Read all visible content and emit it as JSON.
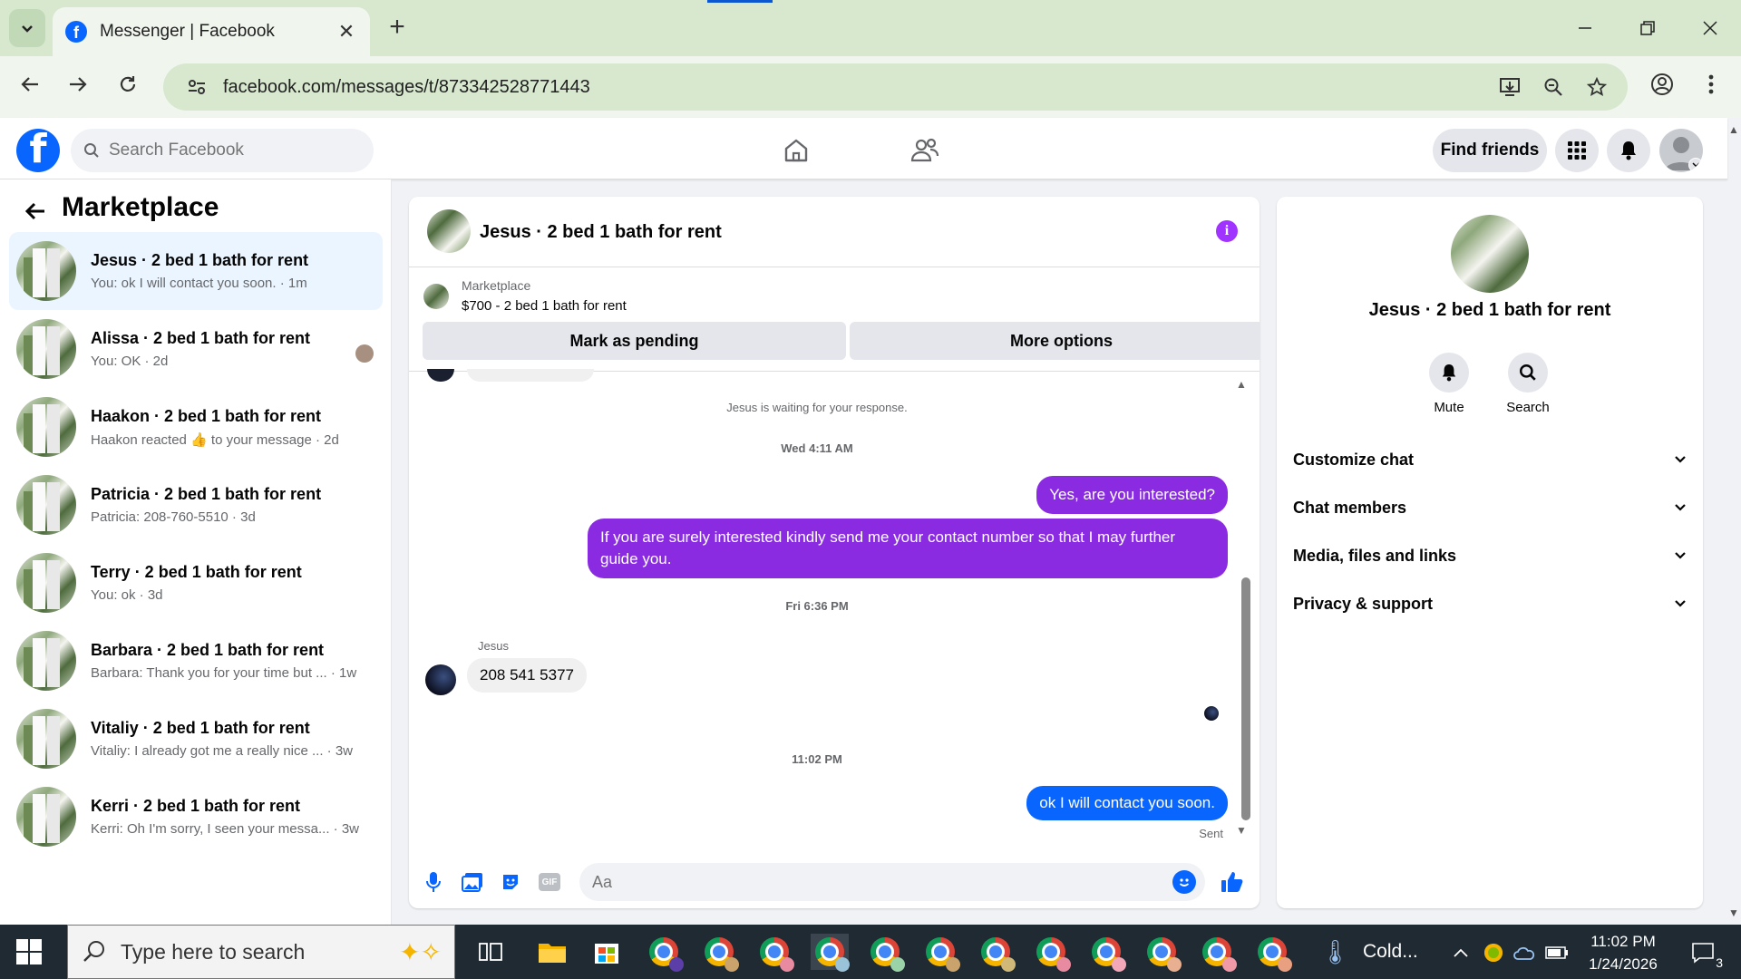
{
  "browser": {
    "tab_title": "Messenger | Facebook",
    "url": "facebook.com/messages/t/873342528771443"
  },
  "fb_header": {
    "search_placeholder": "Search Facebook",
    "find_friends_label": "Find friends"
  },
  "sidebar": {
    "title": "Marketplace",
    "conversations": [
      {
        "name": "Jesus · 2 bed 1 bath for rent",
        "preview": "You: ok I will contact you soon. · 1m",
        "active": true
      },
      {
        "name": "Alissa · 2 bed 1 bath for rent",
        "preview": "You: OK · 2d"
      },
      {
        "name": "Haakon · 2 bed 1 bath for rent",
        "preview": "Haakon reacted 👍 to your message · 2d"
      },
      {
        "name": "Patricia · 2 bed 1 bath for rent",
        "preview": "Patricia: 208-760-5510 · 3d"
      },
      {
        "name": "Terry · 2 bed 1 bath for rent",
        "preview": "You: ok · 3d"
      },
      {
        "name": "Barbara · 2 bed 1 bath for rent",
        "preview": "Barbara: Thank you for your time but ... · 1w"
      },
      {
        "name": "Vitaliy · 2 bed 1 bath for rent",
        "preview": "Vitaliy: I already got me a really nice ... · 3w"
      },
      {
        "name": "Kerri · 2 bed 1 bath for rent",
        "preview": "Kerri: Oh I'm sorry, I seen your messa... · 3w"
      }
    ]
  },
  "chat": {
    "title": "Jesus · 2 bed 1 bath for rent",
    "marketplace_label": "Marketplace",
    "listing": "$700 - 2 bed 1 bath for rent",
    "mark_pending_label": "Mark as pending",
    "more_options_label": "More options",
    "waiting_text": "Jesus is waiting for your response.",
    "ts1": "Wed 4:11 AM",
    "msg1": "Yes, are you interested?",
    "msg2": "If you are surely interested kindly send me your contact number so that I may further guide you.",
    "ts2": "Fri 6:36 PM",
    "sender": "Jesus",
    "msg3": "208 541 5377",
    "ts3": "11:02 PM",
    "msg4": "ok I will contact you soon.",
    "status": "Sent",
    "composer_placeholder": "Aa",
    "gif_label": "GIF"
  },
  "right_panel": {
    "name": "Jesus · 2 bed 1 bath for rent",
    "mute_label": "Mute",
    "search_label": "Search",
    "sections": [
      "Customize chat",
      "Chat members",
      "Media, files and links",
      "Privacy & support"
    ]
  },
  "taskbar": {
    "search_placeholder": "Type here to search",
    "weather": "Cold...",
    "time": "11:02 PM",
    "date": "1/24/2026",
    "notification_count": "3"
  },
  "colors": {
    "fb_blue": "#0866ff",
    "message_purple": "#8a2be2",
    "info_purple": "#a033ff"
  }
}
